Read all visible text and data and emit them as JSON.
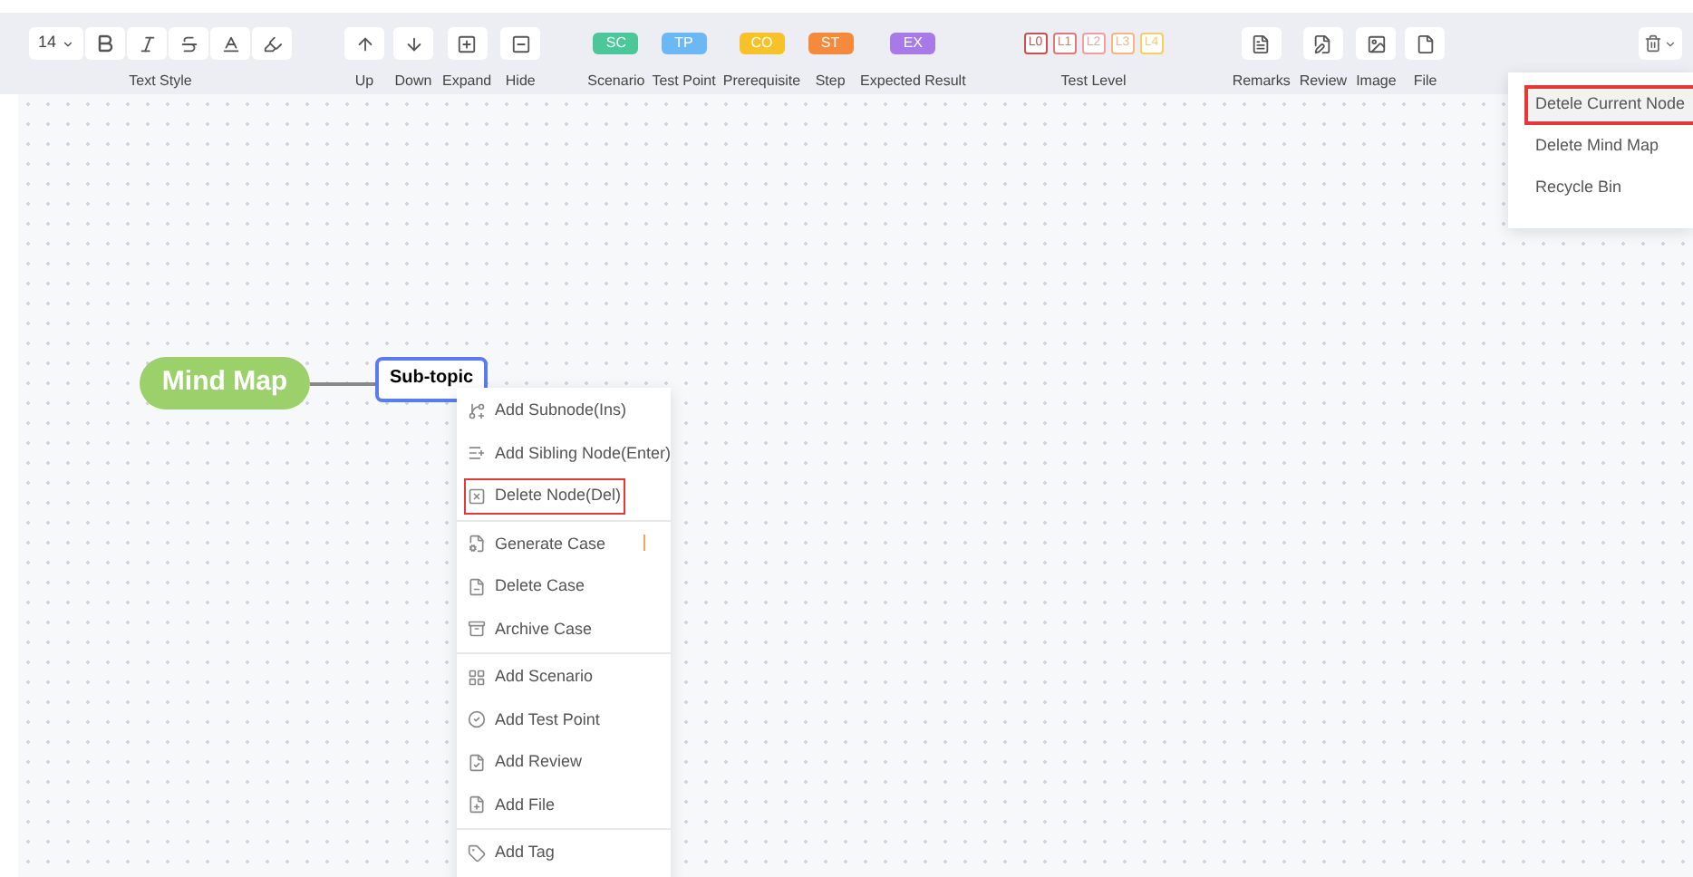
{
  "toolbar": {
    "font_size": "14",
    "text_style_label": "Text Style",
    "nav_buttons": [
      "Up",
      "Down",
      "Expand",
      "Hide"
    ],
    "tags": [
      {
        "code": "SC",
        "label": "Scenario",
        "color": "#4cc79a"
      },
      {
        "code": "TP",
        "label": "Test Point",
        "color": "#6cb8f5"
      },
      {
        "code": "CO",
        "label": "Prerequisite",
        "color": "#f7c12a"
      },
      {
        "code": "ST",
        "label": "Step",
        "color": "#f58a3d"
      },
      {
        "code": "EX",
        "label": "Expected Result",
        "color": "#a77ae8"
      }
    ],
    "levels": [
      {
        "code": "L0",
        "color": "#c9504e"
      },
      {
        "code": "L1",
        "color": "#e07878"
      },
      {
        "code": "L2",
        "color": "#f0a0a0"
      },
      {
        "code": "L3",
        "color": "#f5b785"
      },
      {
        "code": "L4",
        "color": "#f3cf66"
      }
    ],
    "test_level_label": "Test Level",
    "attach_buttons": [
      "Remarks",
      "Review",
      "Image",
      "File"
    ]
  },
  "delete_menu": {
    "items": [
      {
        "label": "Detele Current Node",
        "highlighted": true
      },
      {
        "label": "Delete Mind Map",
        "highlighted": false
      },
      {
        "label": "Recycle Bin",
        "highlighted": false
      }
    ]
  },
  "mind_map": {
    "root": "Mind Map",
    "child": "Sub-topic"
  },
  "context_menu": {
    "groups": [
      {
        "items": [
          {
            "label": "Add Subnode(Ins)",
            "highlighted": false
          },
          {
            "label": "Add Sibling Node(Enter)",
            "highlighted": false
          },
          {
            "label": "Delete Node(Del)",
            "highlighted": true
          }
        ]
      },
      {
        "items": [
          {
            "label": "Generate Case",
            "highlighted": false
          },
          {
            "label": "Delete Case",
            "highlighted": false
          },
          {
            "label": "Archive Case",
            "highlighted": false
          }
        ]
      },
      {
        "items": [
          {
            "label": "Add Scenario",
            "highlighted": false
          },
          {
            "label": "Add Test Point",
            "highlighted": false
          },
          {
            "label": "Add Review",
            "highlighted": false
          },
          {
            "label": "Add File",
            "highlighted": false
          }
        ]
      },
      {
        "items": [
          {
            "label": "Add Tag",
            "highlighted": false
          }
        ]
      }
    ]
  }
}
